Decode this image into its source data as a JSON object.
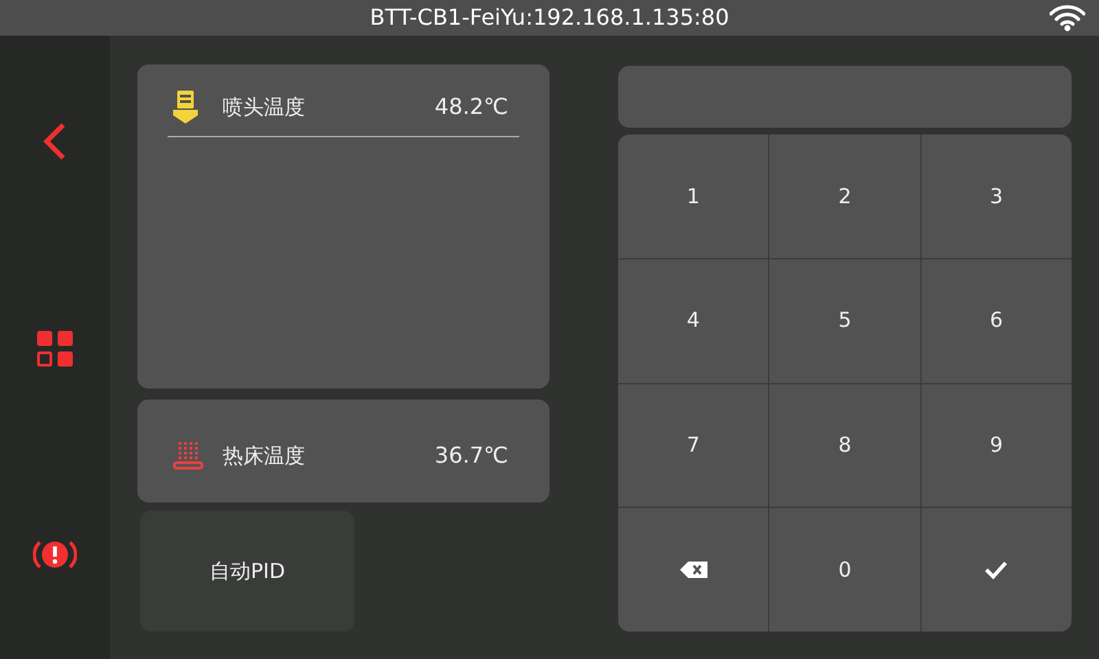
{
  "status_bar": {
    "title": "BTT-CB1-FeiYu:192.168.1.135:80"
  },
  "sensors": [
    {
      "kind": "extruder",
      "label": "喷头温度",
      "value": "48.2℃",
      "expanded": true
    },
    {
      "kind": "bed",
      "label": "热床温度",
      "value": "36.7℃",
      "expanded": false
    }
  ],
  "pid_button": {
    "label": "自动PID"
  },
  "keypad": {
    "keys": [
      {
        "kind": "digit",
        "label": "1"
      },
      {
        "kind": "digit",
        "label": "2"
      },
      {
        "kind": "digit",
        "label": "3"
      },
      {
        "kind": "digit",
        "label": "4"
      },
      {
        "kind": "digit",
        "label": "5"
      },
      {
        "kind": "digit",
        "label": "6"
      },
      {
        "kind": "digit",
        "label": "7"
      },
      {
        "kind": "digit",
        "label": "8"
      },
      {
        "kind": "digit",
        "label": "9"
      },
      {
        "kind": "backspace"
      },
      {
        "kind": "digit",
        "label": "0"
      },
      {
        "kind": "confirm"
      }
    ]
  }
}
